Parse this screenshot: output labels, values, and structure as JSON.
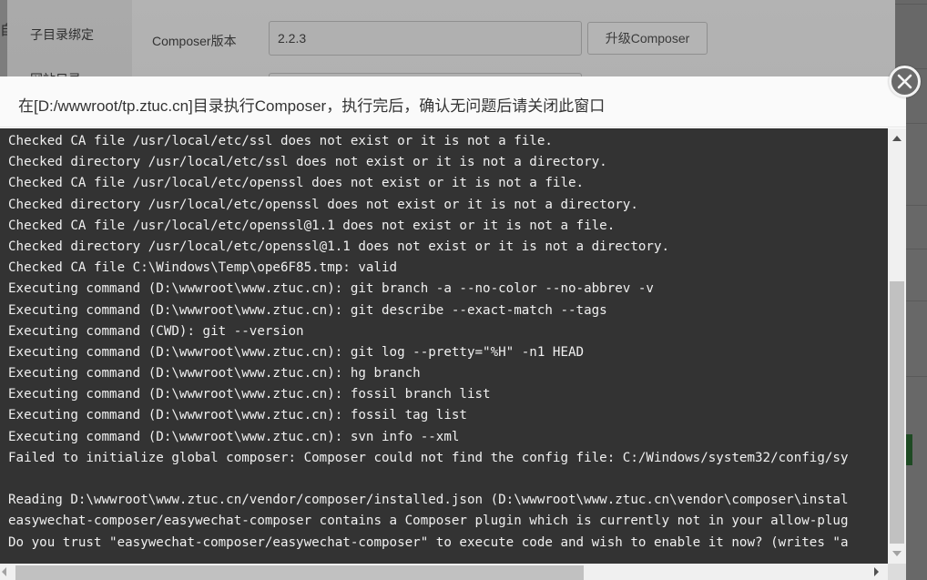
{
  "background": {
    "left_cut_char": "自",
    "sidebar": {
      "items": [
        {
          "label": "子目录绑定"
        },
        {
          "label": "网站目录"
        }
      ]
    },
    "composer_version_label": "Composer版本",
    "composer_version_value": "2.2.3",
    "upgrade_button_label": "升级Composer"
  },
  "modal": {
    "title": "在[D:/wwwroot/tp.ztuc.cn]目录执行Composer，执行完后，确认无问题后请关闭此窗口",
    "close_icon": "close-circle-icon",
    "console": {
      "lines": [
        "Checked CA file /usr/local/etc/ssl does not exist or it is not a file.",
        "Checked directory /usr/local/etc/ssl does not exist or it is not a directory.",
        "Checked CA file /usr/local/etc/openssl does not exist or it is not a file.",
        "Checked directory /usr/local/etc/openssl does not exist or it is not a directory.",
        "Checked CA file /usr/local/etc/openssl@1.1 does not exist or it is not a file.",
        "Checked directory /usr/local/etc/openssl@1.1 does not exist or it is not a directory.",
        "Checked CA file C:\\Windows\\Temp\\ope6F85.tmp: valid",
        "Executing command (D:\\wwwroot\\www.ztuc.cn): git branch -a --no-color --no-abbrev -v",
        "Executing command (D:\\wwwroot\\www.ztuc.cn): git describe --exact-match --tags",
        "Executing command (CWD): git --version",
        "Executing command (D:\\wwwroot\\www.ztuc.cn): git log --pretty=\"%H\" -n1 HEAD",
        "Executing command (D:\\wwwroot\\www.ztuc.cn): hg branch",
        "Executing command (D:\\wwwroot\\www.ztuc.cn): fossil branch list",
        "Executing command (D:\\wwwroot\\www.ztuc.cn): fossil tag list",
        "Executing command (D:\\wwwroot\\www.ztuc.cn): svn info --xml",
        "Failed to initialize global composer: Composer could not find the config file: C:/Windows/system32/config/sy",
        "",
        "Reading D:\\wwwroot\\www.ztuc.cn/vendor/composer/installed.json (D:\\wwwroot\\www.ztuc.cn\\vendor\\composer\\instal",
        "easywechat-composer/easywechat-composer contains a Composer plugin which is currently not in your allow-plug",
        "Do you trust \"easywechat-composer/easywechat-composer\" to execute code and wish to enable it now? (writes \"a"
      ]
    }
  }
}
